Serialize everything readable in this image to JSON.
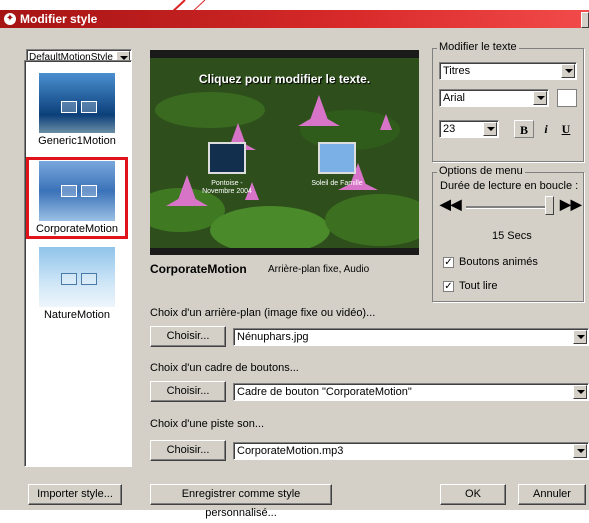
{
  "window": {
    "title": "Modifier style"
  },
  "style_select": {
    "value": "DefaultMotionStyle"
  },
  "styles": [
    {
      "label": "Generic1Motion"
    },
    {
      "label": "CorporateMotion"
    },
    {
      "label": "NatureMotion"
    }
  ],
  "preview": {
    "title": "Cliquez pour modifier le texte.",
    "caption_left": "Pontoise - Novembre 2004",
    "caption_right": "Soleil de Famille"
  },
  "style_info": {
    "name": "CorporateMotion",
    "description": "Arrière-plan fixe, Audio"
  },
  "text_group": {
    "label": "Modifier le texte",
    "target": "Titres",
    "font": "Arial",
    "size": "23",
    "bold": "B",
    "italic": "i",
    "underline": "U"
  },
  "menu_group": {
    "label": "Options de menu",
    "loop_label": "Durée de lecture en boucle :",
    "loop_value": "15 Secs",
    "loop_fraction": 1.0,
    "animated_buttons": "Boutons animés",
    "play_all": "Tout lire"
  },
  "background": {
    "label": "Choix d'un arrière-plan (image fixe ou vidéo)...",
    "button": "Choisir...",
    "value": "Nénuphars.jpg"
  },
  "button_frame": {
    "label": "Choix d'un cadre de boutons...",
    "button": "Choisir...",
    "value": "Cadre de bouton \"CorporateMotion\""
  },
  "sound": {
    "label": "Choix d'une piste son...",
    "button": "Choisir...",
    "value": "CorporateMotion.mp3"
  },
  "footer": {
    "import": "Importer style...",
    "save_custom": "Enregistrer comme style personnalisé...",
    "ok": "OK",
    "cancel": "Annuler"
  },
  "colors": {
    "title_bar": "#c11d1d",
    "selection_outline": "#e0121a",
    "dialog_bg": "#d4d0c8"
  }
}
